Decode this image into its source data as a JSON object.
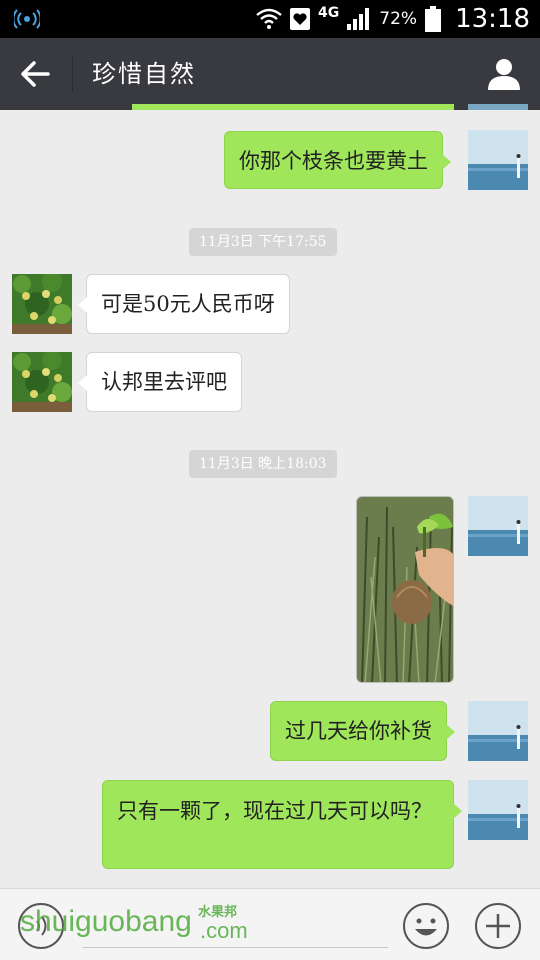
{
  "status_bar": {
    "network": "4G",
    "battery": "72%",
    "time": "13:18"
  },
  "header": {
    "title": "珍惜自然"
  },
  "messages": [
    {
      "type": "text",
      "direction": "out",
      "text": "你那个枝条也要黄土"
    },
    {
      "type": "timestamp",
      "text": "11月3日 下午17:55"
    },
    {
      "type": "text",
      "direction": "in",
      "text": "可是50元人民币呀"
    },
    {
      "type": "text",
      "direction": "in",
      "text": "认邦里去评吧"
    },
    {
      "type": "timestamp",
      "text": "11月3日 晚上18:03"
    },
    {
      "type": "image",
      "direction": "out"
    },
    {
      "type": "text",
      "direction": "out",
      "text": "过几天给你补货"
    },
    {
      "type": "text",
      "direction": "out",
      "text": "只有一颗了，现在过几天可以吗？"
    }
  ],
  "watermark": {
    "main": "shuiguobang",
    "cn": "水果邦",
    "com": ".com"
  },
  "colors": {
    "outgoing_bubble": "#9fe65a",
    "incoming_bubble": "#ffffff",
    "title_bar": "#393a3f",
    "background": "#ececec"
  }
}
